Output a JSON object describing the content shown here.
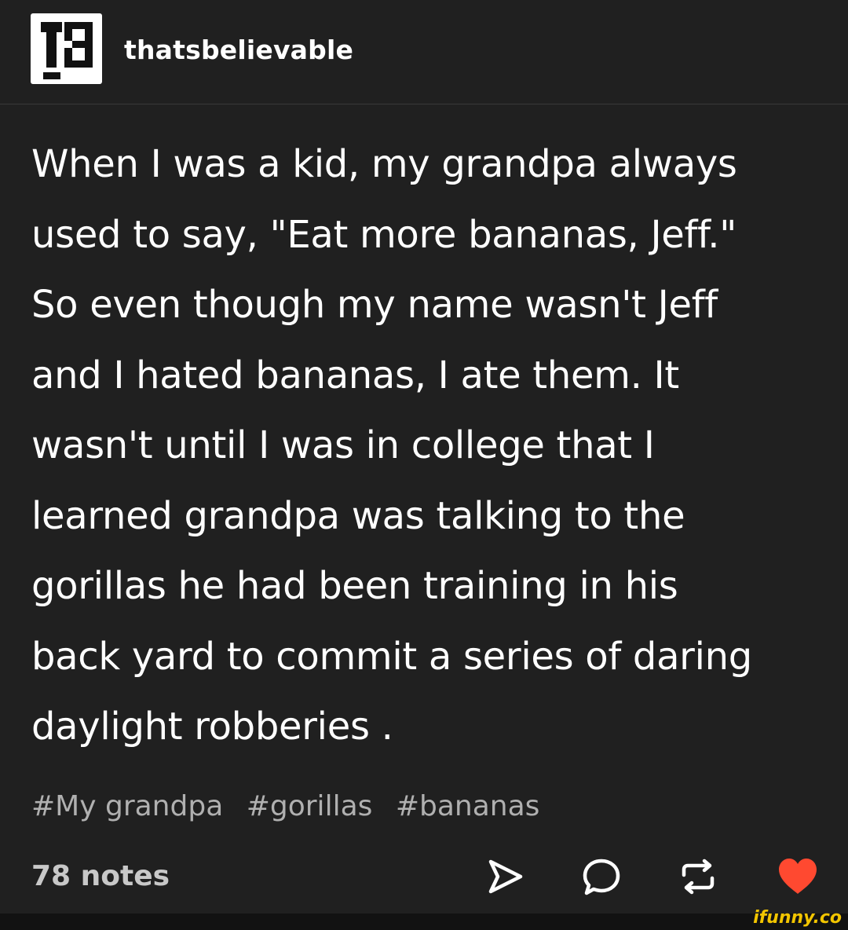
{
  "post": {
    "blog_name": "thatsbelievable",
    "avatar_icon": "tb-logo-icon",
    "body_lines": [
      "When I was a kid, my grandpa always",
      "used to say, \"Eat more bananas, Jeff.\"",
      "So even though my name wasn't Jeff",
      "and I hated bananas, I ate them. It",
      "wasn't until I was in college that I",
      "learned grandpa was talking to the",
      "gorillas he had been training in his",
      "back yard to commit a series of daring",
      "daylight robberies ."
    ],
    "tags": [
      "#My grandpa",
      "#gorillas",
      "#bananas"
    ],
    "notes": "78 notes",
    "actions": {
      "share_icon": "share-icon",
      "reply_icon": "reply-icon",
      "reblog_icon": "reblog-icon",
      "like_icon": "heart-icon",
      "like_color": "#ff4930"
    }
  },
  "colors": {
    "background": "#202020",
    "text": "#ffffff",
    "tag_text": "#b0b0b0",
    "watermark": "#f2c500"
  },
  "watermark": "ifunny.co"
}
